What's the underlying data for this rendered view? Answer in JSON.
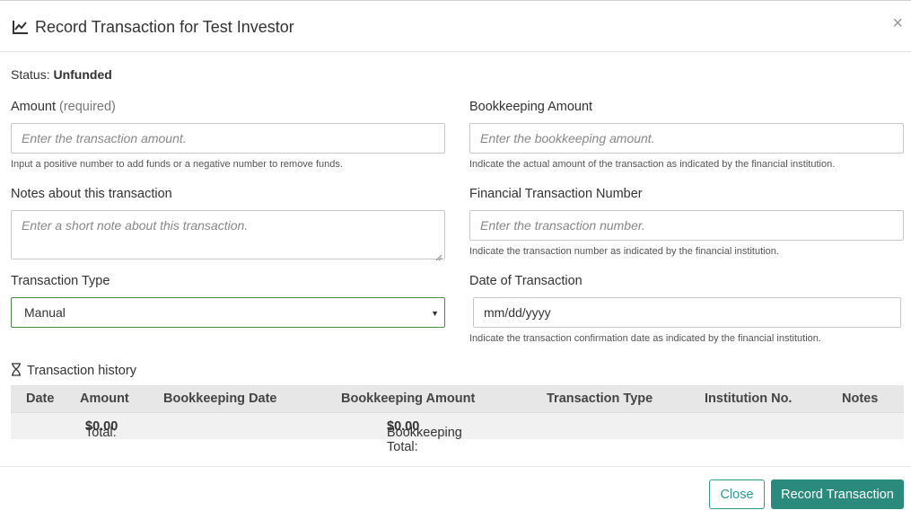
{
  "modal": {
    "title": "Record Transaction for Test Investor",
    "close_symbol": "×"
  },
  "status": {
    "label": "Status:",
    "value": "Unfunded"
  },
  "form": {
    "amount": {
      "label": "Amount",
      "label_suffix": "(required)",
      "placeholder": "Enter the transaction amount.",
      "help": "Input a positive number to add funds or a negative number to remove funds."
    },
    "bookkeeping_amount": {
      "label": "Bookkeeping Amount",
      "placeholder": "Enter the bookkeeping amount.",
      "help": "Indicate the actual amount of the transaction as indicated by the financial institution."
    },
    "notes": {
      "label": "Notes about this transaction",
      "placeholder": "Enter a short note about this transaction."
    },
    "financial_number": {
      "label": "Financial Transaction Number",
      "placeholder": "Enter the transaction number.",
      "help": "Indicate the transaction number as indicated by the financial institution."
    },
    "transaction_type": {
      "label": "Transaction Type",
      "selected": "Manual"
    },
    "date": {
      "label": "Date of Transaction",
      "value": "mm/dd/yyyy",
      "help": "Indicate the transaction confirmation date as indicated by the financial institution."
    }
  },
  "history": {
    "title": "Transaction history",
    "columns": [
      "Date",
      "Amount",
      "Bookkeeping Date",
      "Bookkeeping Amount",
      "Transaction Type",
      "Institution No.",
      "Notes"
    ],
    "total_label": "Total:",
    "total_value": "$0.00",
    "bookkeeping_total_label": "Bookkeeping Total:",
    "bookkeeping_total_value": "$0.00"
  },
  "buttons": {
    "close": "Close",
    "record": "Record Transaction"
  },
  "colors": {
    "accent": "#2a8a7c",
    "select_border": "#4e8a4a"
  }
}
